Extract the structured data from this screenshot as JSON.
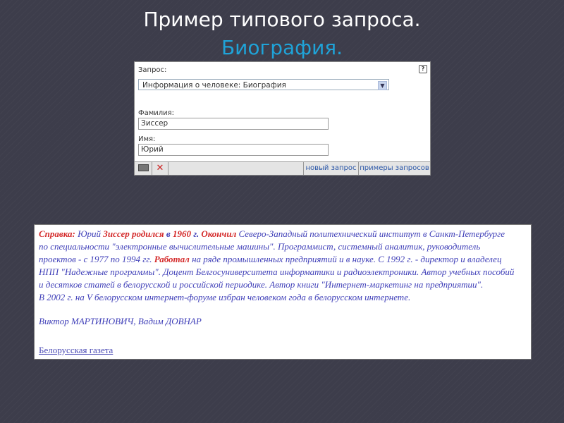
{
  "slide": {
    "title": "Пример типового запроса.",
    "subtitle": "Биография."
  },
  "form": {
    "query_label": "Запрос:",
    "query_value": "Информация о человеке: Биография",
    "help": "?",
    "surname_label": "Фамилия:",
    "surname_value": "Зиссер",
    "name_label": "Имя:",
    "name_value": "Юрий",
    "keyboard_icon": "keyboard-icon",
    "clear_icon": "✕",
    "new_query": "новый запрос",
    "examples": "примеры запросов"
  },
  "bio": {
    "lines": [
      [
        "Справка:",
        " Юрий ",
        "Зиссер родился",
        " в ",
        "1960",
        " г. ",
        "Окончил",
        " Северо-Западный политехнический институт в Санкт-Петербурге"
      ],
      [
        "по специальности \"электронные вычислительные машины\". Программист, системный аналитик, руководитель"
      ],
      [
        "проектов - с 1977 по 1994 гг. ",
        "Работал",
        " на ряде промышленных предприятий и в науке. С 1992 г. - директор и владелец"
      ],
      [
        "НПП \"Надежные программы\". Доцент Белгосуниверситета информатики и радиоэлектроники. Автор учебных пособий"
      ],
      [
        "и десятков статей в белорусской и российской периодике. Автор книги \"Интернет-маркетинг на предприятии\"."
      ],
      [
        "В 2002 г. на V белорусском интернет-форуме избран человеком года в белорусском интернете."
      ]
    ],
    "authors": "Виктор МАРТИНОВИЧ, Вадим ДОВНАР",
    "source": "Белорусская газета"
  }
}
